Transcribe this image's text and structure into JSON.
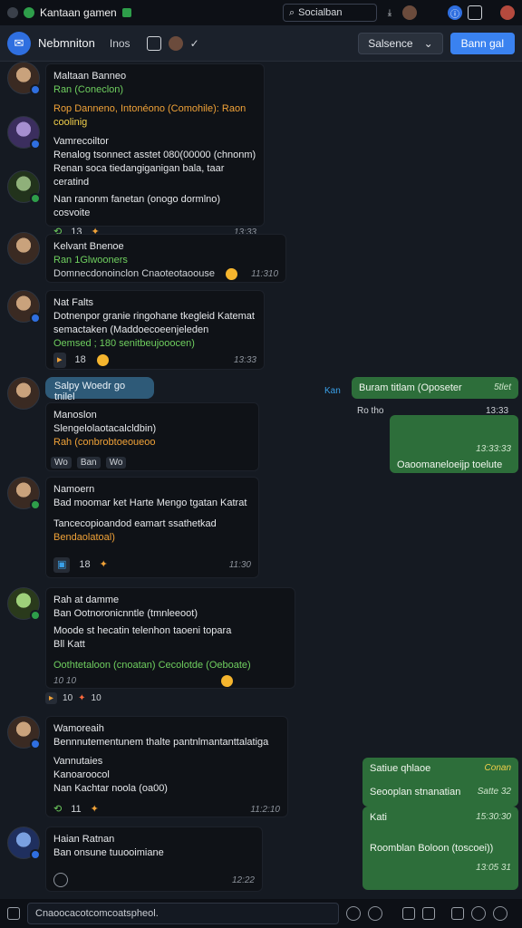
{
  "app": {
    "title": "Kantaan gamen",
    "search_label": "Socialban"
  },
  "header": {
    "chat_name": "Nebmniton",
    "chat_sub": "Inos",
    "select_label": "Salsence",
    "primary_label": "Bann gal"
  },
  "messages": [
    {
      "lines": [
        {
          "text": "Maltaan Banneo",
          "color": "white"
        },
        {
          "text": "Ran (Coneclon)",
          "color": "green"
        },
        {
          "text": "Rop Danneno, Intonéono (Comohile): Raon",
          "color": "orange"
        },
        {
          "text": "coolinig",
          "color": "yellow"
        },
        {
          "text": "Vamrecoiltor",
          "color": "white"
        },
        {
          "text": "Renalog tsonnect asstet 080(00000 (chnonm)",
          "color": "white"
        },
        {
          "text": "Renan soca tiedangiganigan bala, taar",
          "color": "white"
        },
        {
          "text": "ceratind",
          "color": "white"
        },
        {
          "text": "Nan ranonm   fanetan (onogo dormlno)",
          "color": "white"
        },
        {
          "text": "cosvoite",
          "color": "white"
        }
      ],
      "meta_count": "13",
      "time": "13:33"
    },
    {
      "lines": [
        {
          "text": "Kelvant Bnenoe",
          "color": "white"
        },
        {
          "text": "Ran 1Glwooners",
          "color": "green"
        },
        {
          "text": "Domnecdonoinclon Cnaoteotaoouse",
          "color": "white"
        }
      ],
      "time": "11:310"
    },
    {
      "lines": [
        {
          "text": "Nat Falts",
          "color": "white"
        },
        {
          "text": "Dotnenpor granie ringohane tkegleid Katemat",
          "color": "white"
        },
        {
          "text": "semactaken (Maddoecoeenjeleden",
          "color": "white"
        },
        {
          "text": "Oemsed ; 180 senitbeujooocen)",
          "color": "green"
        }
      ],
      "meta_count": "18",
      "time": "13:33"
    },
    {
      "header": "Salpy Woedr go tnilel",
      "lines": [
        {
          "text": "Manoslon",
          "color": "white"
        },
        {
          "text": "Slengelolaotacalcldbin)",
          "color": "white"
        },
        {
          "text": "Rah (conbrobtoeoueoo",
          "color": "orange"
        }
      ],
      "tags": [
        "Wo",
        "Ban",
        "Wo"
      ]
    },
    {
      "lines": [
        {
          "text": "Namoern",
          "color": "white"
        },
        {
          "text": "Bad moomar ket Harte Mengo tgatan Katrat",
          "color": "white"
        },
        {
          "text": "Tancecopioandod eamart ssathetkad",
          "color": "white"
        },
        {
          "text": "Bendaolatoal)",
          "color": "orange"
        }
      ],
      "meta_count": "18",
      "time": "11:30"
    },
    {
      "lines": [
        {
          "text": "Rah at damme",
          "color": "white"
        },
        {
          "text": "Ban Ootnoronicnntle (tmnleeoot)",
          "color": "white"
        },
        {
          "text": "Moode st hecatin telenhon taoeni topara",
          "color": "white"
        },
        {
          "text": "Bll Katt",
          "color": "white"
        },
        {
          "text": "Oothtetaloon (cnoatan) Cecolotde (Oeboate)",
          "color": "green"
        }
      ],
      "time": "10 10"
    },
    {
      "lines": [
        {
          "text": "Wamoreaih",
          "color": "white"
        },
        {
          "text": "Bennnutementunem thalte pantnlmantanttalatiga",
          "color": "white"
        },
        {
          "text": "Vannutaies",
          "color": "white"
        },
        {
          "text": "Kanoaroocol",
          "color": "white"
        },
        {
          "text": "Nan Kachtar noola (oa00)",
          "color": "white"
        }
      ],
      "meta_count": "11",
      "time": "11:2:10"
    },
    {
      "lines": [
        {
          "text": "Haian Ratnan",
          "color": "white"
        },
        {
          "text": "Ban onsune tuuooimiane",
          "color": "white"
        }
      ],
      "time": "12:22"
    }
  ],
  "outgoing": [
    {
      "text": "Buram titlam (Oposeter",
      "time": "5tlet"
    },
    {
      "text": "Ro tho",
      "time": "13:33"
    },
    {
      "text": "Oaoomaneloeijp toelute",
      "time": "13:33:33"
    },
    {
      "text": "Satiue qhlaoe",
      "time": "Conan"
    },
    {
      "text": "Seooplan stnanatian",
      "time": "Satte 32"
    },
    {
      "text": "Kati",
      "time": "15:30:30"
    },
    {
      "text": "Roomblan Boloon (toscoei))",
      "time": "13:05 31"
    }
  ],
  "side_label": "Kan",
  "reaction_strip": [
    "10",
    "10"
  ],
  "composer": {
    "placeholder": "Cnaoocacotcomcoatspheol."
  }
}
